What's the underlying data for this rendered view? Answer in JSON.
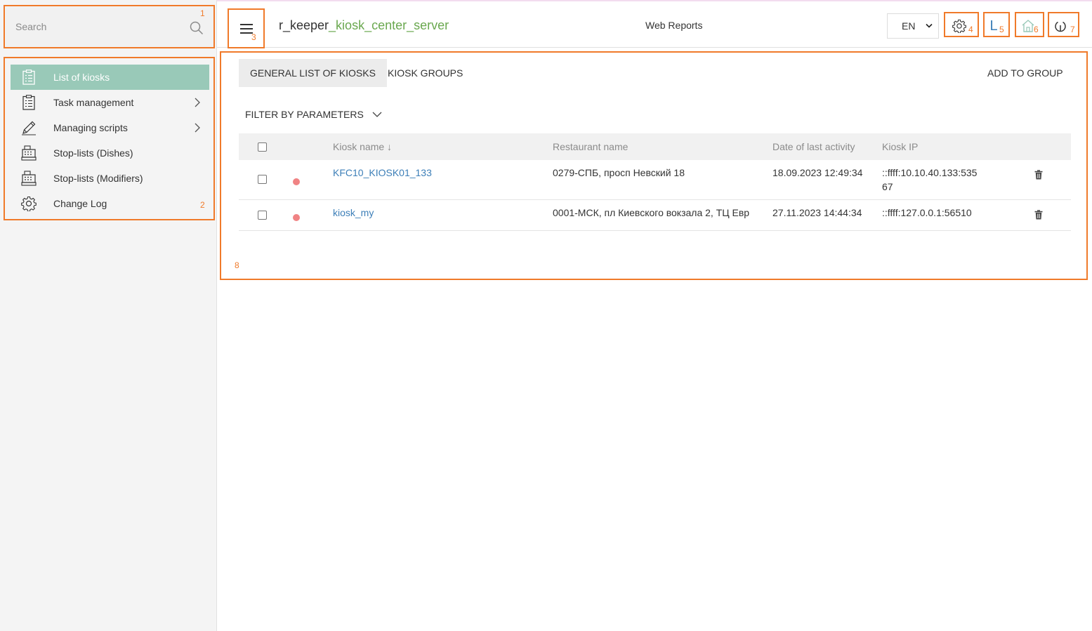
{
  "search": {
    "placeholder": "Search"
  },
  "sidebar": {
    "items": [
      {
        "label": "List of kiosks",
        "icon": "clipboard-list-icon",
        "active": true
      },
      {
        "label": "Task management",
        "icon": "clipboard-list-icon",
        "has_submenu": true
      },
      {
        "label": "Managing scripts",
        "icon": "pencil-icon",
        "has_submenu": true
      },
      {
        "label": "Stop-lists (Dishes)",
        "icon": "cash-register-icon"
      },
      {
        "label": "Stop-lists (Modifiers)",
        "icon": "cash-register-icon"
      },
      {
        "label": "Change Log",
        "icon": "gear-icon"
      }
    ]
  },
  "header": {
    "title_prefix": "r_keeper",
    "title_accent": "_kiosk_center_server",
    "web_reports": "Web Reports",
    "language": "EN",
    "buttons": [
      {
        "icon": "gear-icon"
      },
      {
        "icon": "letter-l-icon",
        "text": "L"
      },
      {
        "icon": "house-icon"
      },
      {
        "icon": "power-icon"
      }
    ]
  },
  "annotations": [
    "1",
    "2",
    "3",
    "4",
    "5",
    "6",
    "7",
    "8"
  ],
  "tabs": [
    {
      "label": "GENERAL LIST OF KIOSKS",
      "active": true
    },
    {
      "label": "KIOSK GROUPS"
    }
  ],
  "add_to_group": "ADD TO GROUP",
  "filter": {
    "label": "FILTER BY PARAMETERS"
  },
  "table": {
    "columns": [
      "Kiosk name ↓",
      "Restaurant name",
      "Date of last activity",
      "Kiosk IP"
    ],
    "rows": [
      {
        "kiosk_name": "KFC10_KIOSK01_133",
        "restaurant": "0279-СПБ, просп Невский 18",
        "last_activity": "18.09.2023 12:49:34",
        "ip_line1": "::ffff:10.10.40.133:535",
        "ip_line2": "67",
        "status_color": "#f08384"
      },
      {
        "kiosk_name": "kiosk_my",
        "restaurant": "0001-МСК, пл Киевского вокзала 2, ТЦ Евр",
        "last_activity": "27.11.2023 14:44:34",
        "ip_line1": "::ffff:127.0.0.1:56510",
        "ip_line2": "",
        "status_color": "#f08384"
      }
    ]
  },
  "colors": {
    "accent_green": "#6aa84f",
    "active_nav": "#99c9b8",
    "annotation_orange": "#f07a2a",
    "link_blue": "#3d7fb8",
    "status_dot": "#f08384"
  }
}
